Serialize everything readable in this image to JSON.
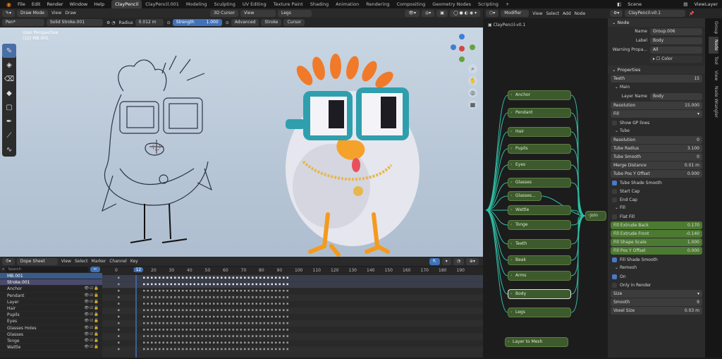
{
  "menu": {
    "items": [
      "File",
      "Edit",
      "Render",
      "Window",
      "Help"
    ],
    "workspaces": [
      "ClayPencil",
      "ClayPencil.001",
      "Modeling",
      "Sculpting",
      "UV Editing",
      "Texture Paint",
      "Shading",
      "Animation",
      "Rendering",
      "Compositing",
      "Geometry Nodes",
      "Scripting"
    ],
    "scene": "Scene",
    "view_layer": "ViewLayer"
  },
  "viewport": {
    "mode": "Draw Mode",
    "view": "View",
    "draw": "Draw",
    "cursor": "3D Cursor",
    "view2": "View",
    "layer": "Legs",
    "brush": "Pen*",
    "material": "Solid Stroke.001",
    "radius_label": "Radius",
    "radius": "0.012 m",
    "strength_label": "Strength",
    "strength": "1.000",
    "advanced": "Advanced",
    "stroke": "Stroke",
    "cursor_menu": "Cursor",
    "overlay_title": "User Perspective",
    "overlay_sub": "(12) MB.001"
  },
  "dopesheet": {
    "mode": "Dope Sheet",
    "menu": [
      "View",
      "Select",
      "Marker",
      "Channel",
      "Key"
    ],
    "search": "Search",
    "frame": "12",
    "ticks": [
      "0",
      "10",
      "20",
      "30",
      "40",
      "50",
      "60",
      "70",
      "80",
      "90",
      "100",
      "110",
      "120",
      "130",
      "140",
      "150",
      "160",
      "170",
      "180",
      "190"
    ],
    "object": "MB.001",
    "stroke": "Stroke.001",
    "channels": [
      "Anchor",
      "Pendant",
      "Layer",
      "Hair",
      "Pupils",
      "Eyes",
      "Glasses Holes",
      "Glasses",
      "Tonge",
      "Wattle"
    ]
  },
  "nodeeditor": {
    "menu": [
      "Modifier",
      "View",
      "Select",
      "Add",
      "Node"
    ],
    "object": "ClayPencil-v0.1",
    "nodes": [
      "Anchor",
      "Pendant",
      "Hair",
      "Pupils",
      "Eyes",
      "Glasses",
      "Glasses...",
      "Wattle",
      "Tonge",
      "Teeth",
      "Beak",
      "Arms",
      "Body",
      "Legs"
    ],
    "join": "Join",
    "layer_to_mesh": "Layer to Mesh"
  },
  "properties": {
    "header": "ClayPencil-v0.1",
    "node_section": "Node",
    "name_label": "Name",
    "name": "Group.006",
    "label_label": "Label",
    "label": "Body",
    "warning_label": "Warning Propa...",
    "warning": "All",
    "color": "Color",
    "props_section": "Properties",
    "teeth": "Teeth",
    "teeth_val": "15",
    "main": "Main",
    "layer_name_label": "Layer Name",
    "layer_name": "Body",
    "resolution": "Resolution",
    "resolution_val": "15.000",
    "fill": "Fill",
    "show_gp": "Show GP lines",
    "tube": "Tube",
    "tube_resolution": "Resolution",
    "tube_resolution_val": "0",
    "tube_radius": "Tube Radius",
    "tube_radius_val": "3.100",
    "tube_smooth": "Tube Smooth",
    "tube_smooth_val": "0",
    "merge": "Merge Distance",
    "merge_val": "0.01 m",
    "tube_pos": "Tube Pos Y Offset",
    "tube_pos_val": "0.000",
    "tube_shade": "Tube Shade Smooth",
    "start_cap": "Start Cap",
    "end_cap": "End Cap",
    "fill_sub": "Fill",
    "flat_fill": "Flat Fill",
    "extrude_back": "Fill Extrude Back",
    "extrude_back_val": "0.170",
    "extrude_front": "Fill Extrude Front",
    "extrude_front_val": "-0.140",
    "shape_scale": "Fill Shape Scale",
    "shape_scale_val": "1.000",
    "pos_y": "Fill Pos Y Offset",
    "pos_y_val": "0.000",
    "fill_shade": "Fill Shade Smooth",
    "remesh": "Remesh",
    "on": "On",
    "only_render": "Only in Render",
    "size": "Size",
    "smooth": "Smooth",
    "smooth_val": "9",
    "voxel": "Voxel Size",
    "voxel_val": "0.03 m"
  },
  "sidetabs": [
    "Group",
    "Node",
    "Tool",
    "View",
    "Node Wrangler"
  ]
}
